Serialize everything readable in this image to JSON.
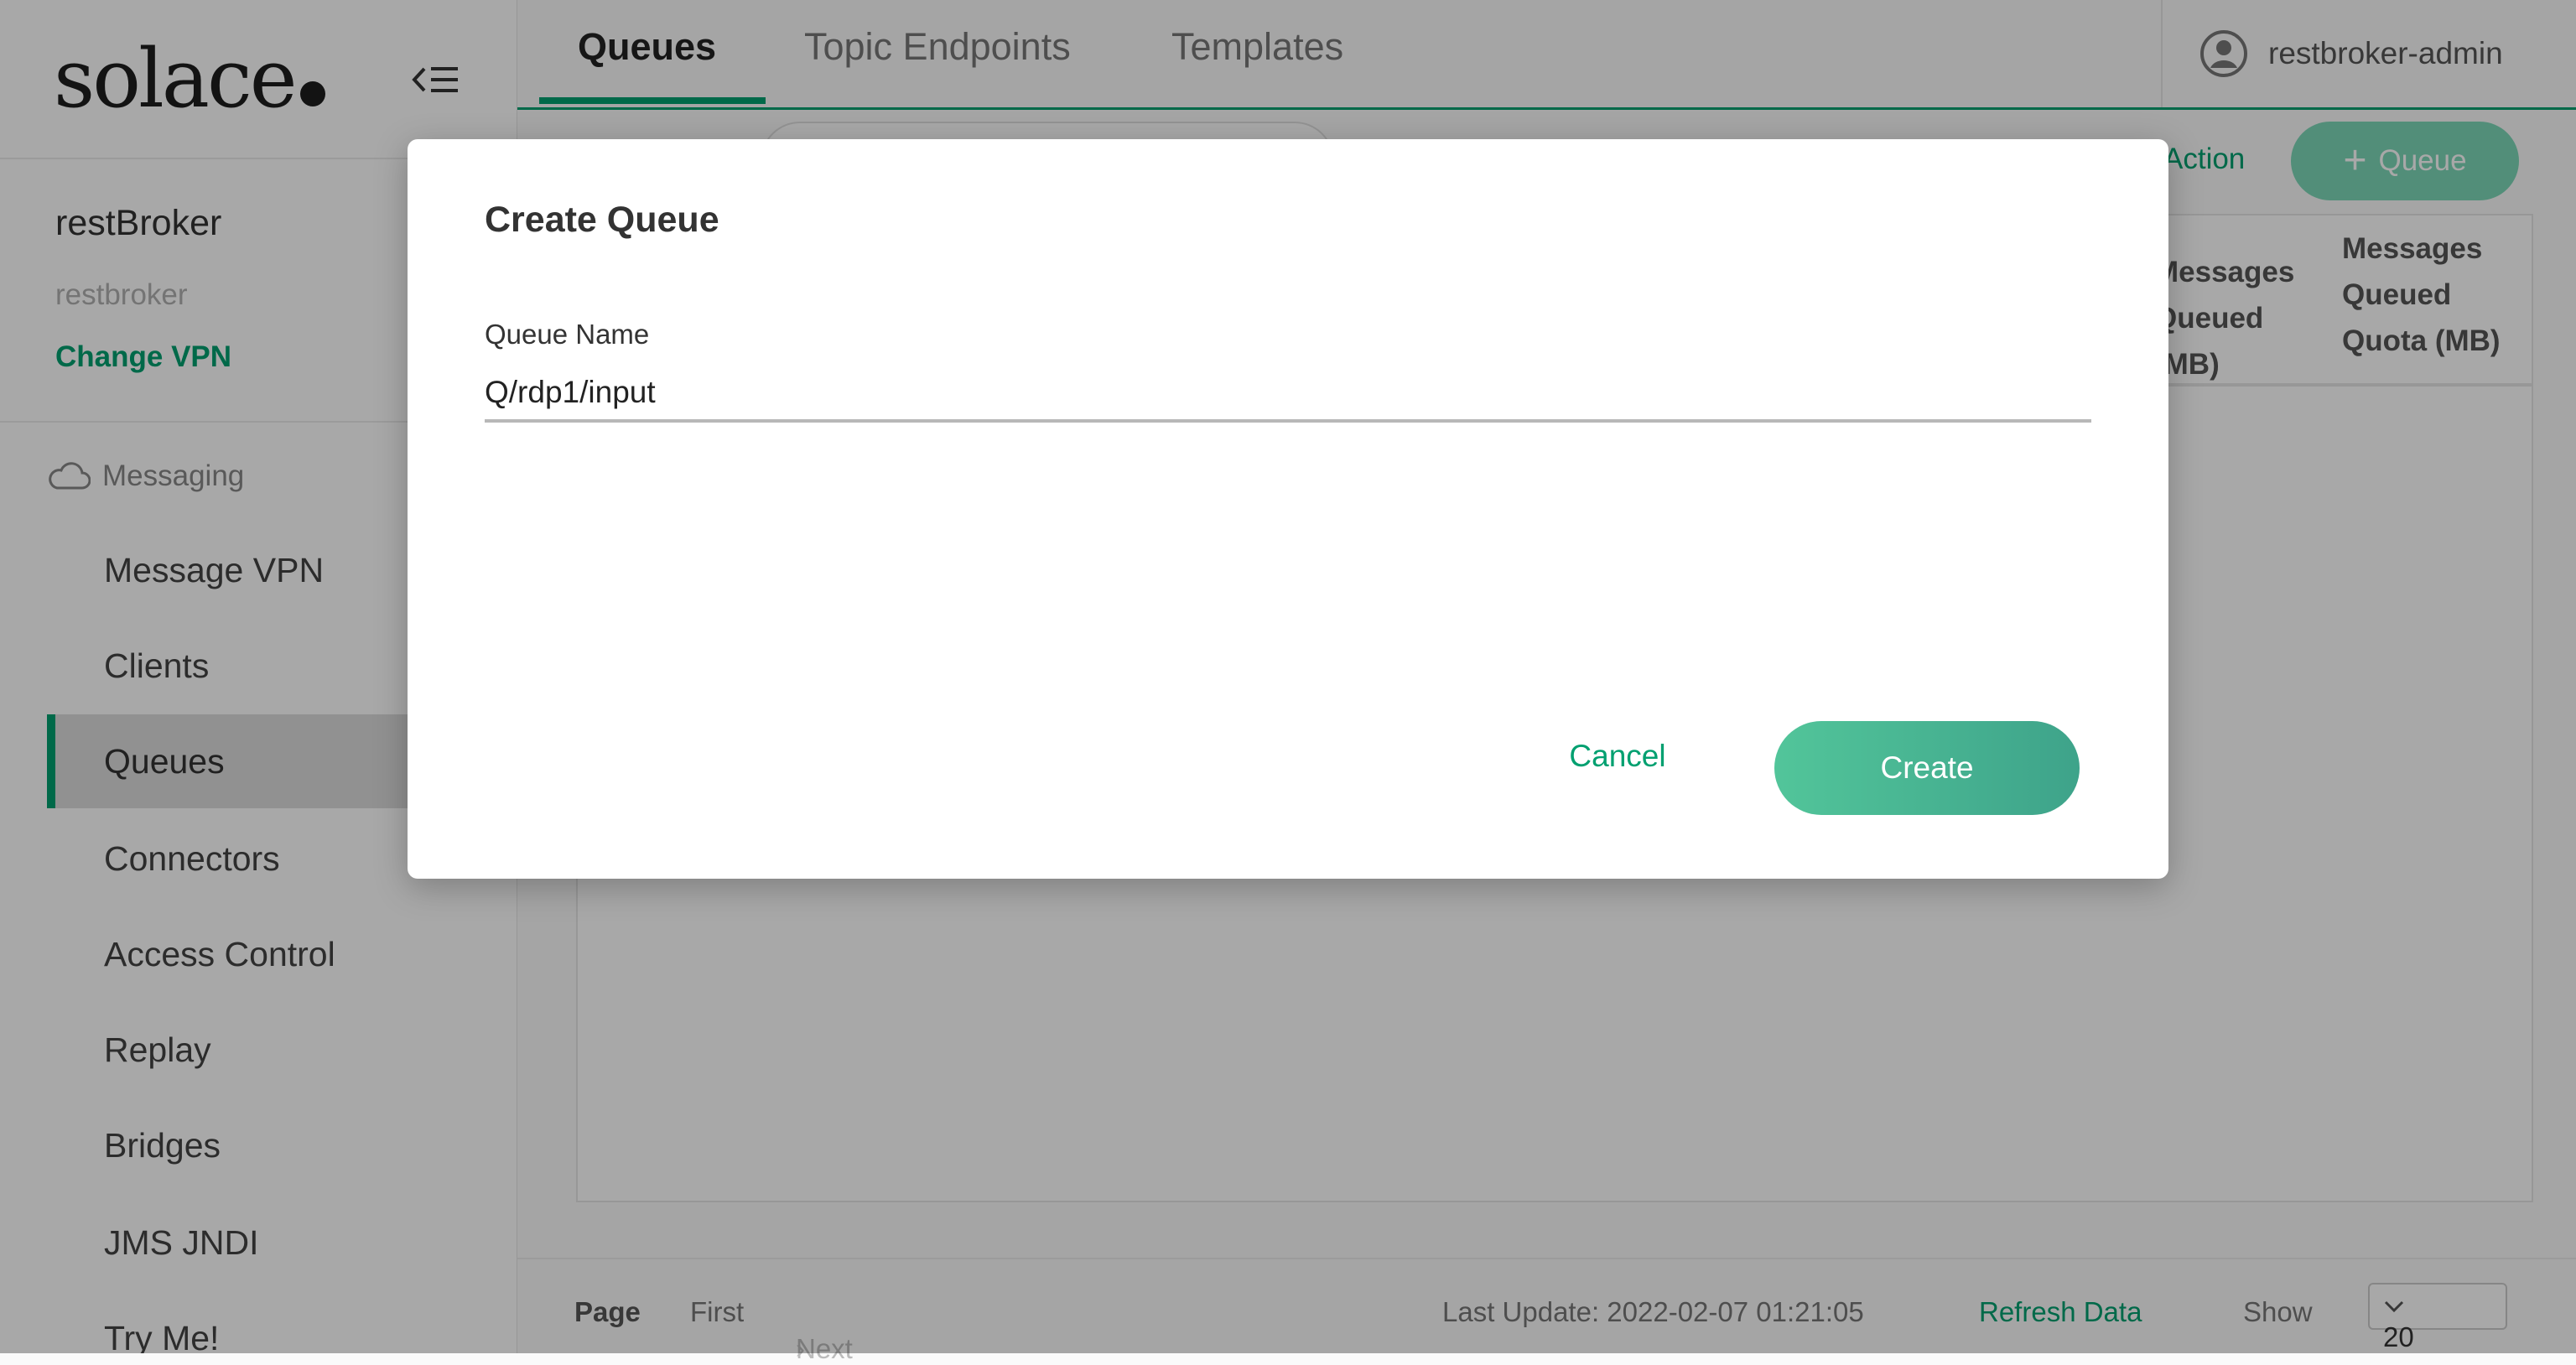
{
  "brand": {
    "name": "solace"
  },
  "sidebar": {
    "vpn_name": "restBroker",
    "vpn_subtitle": "restbroker",
    "change_vpn": "Change VPN",
    "section": "Messaging",
    "items": [
      {
        "label": "Message VPN"
      },
      {
        "label": "Clients"
      },
      {
        "label": "Queues",
        "active": true
      },
      {
        "label": "Connectors"
      },
      {
        "label": "Access Control"
      },
      {
        "label": "Replay"
      },
      {
        "label": "Bridges"
      },
      {
        "label": "JMS JNDI"
      },
      {
        "label": "Try Me!"
      }
    ]
  },
  "tabs": [
    {
      "label": "Queues",
      "active": true
    },
    {
      "label": "Topic Endpoints"
    },
    {
      "label": "Templates"
    }
  ],
  "user": {
    "name": "restbroker-admin"
  },
  "toolbar": {
    "action_label": "Action",
    "add_label": "Queue"
  },
  "table": {
    "columns": [
      "Messages Queued (MB)",
      "Messages Queued Quota (MB)"
    ]
  },
  "footer": {
    "page_label": "Page",
    "first_label": "First",
    "next_label": "Next",
    "last_update": "Last Update: 2022-02-07 01:21:05",
    "refresh_label": "Refresh Data",
    "show_label": "Show",
    "page_size": "20"
  },
  "dialog": {
    "title": "Create Queue",
    "field_label": "Queue Name",
    "field_value": "Q/rdp1/input",
    "cancel_label": "Cancel",
    "create_label": "Create"
  },
  "colors": {
    "accent": "#00a070",
    "create_button": "#4cb896",
    "overlay": "rgba(0,0,0,0.34)"
  }
}
